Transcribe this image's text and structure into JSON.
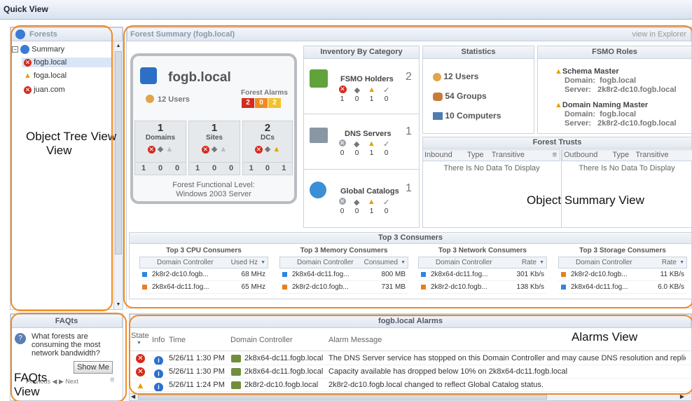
{
  "window": {
    "title": "Quick View"
  },
  "forests_panel": {
    "title": "Forests",
    "tree": [
      {
        "label": "Summary",
        "level": 0
      },
      {
        "label": "fogb.local",
        "level": 1,
        "status": "error"
      },
      {
        "label": "foga.local",
        "level": 1,
        "status": "warning"
      },
      {
        "label": "juan.com",
        "level": 1,
        "status": "error"
      }
    ]
  },
  "annotations": {
    "tree_view": "Object Tree View",
    "summary_view": "Object Summary View",
    "faqts_view_a": "FAQts",
    "faqts_view_b": "View",
    "alarms_view": "Alarms View"
  },
  "summary": {
    "title": "Forest Summary (fogb.local)",
    "view_link": "view in Explorer",
    "forest_name": "fogb.local",
    "users": "12 Users",
    "alarms_label": "Forest Alarms",
    "alarm_counts": [
      "2",
      "0",
      "2"
    ],
    "stats": [
      {
        "num": "1",
        "label": "Domains",
        "counts": [
          "1",
          "0",
          "0"
        ]
      },
      {
        "num": "1",
        "label": "Sites",
        "counts": [
          "1",
          "0",
          "0"
        ]
      },
      {
        "num": "2",
        "label": "DCs",
        "counts": [
          "1",
          "0",
          "1"
        ]
      }
    ],
    "functional_level_label": "Forest Functional Level:",
    "functional_level": "Windows 2003 Server"
  },
  "inventory": {
    "title": "Inventory By Category",
    "items": [
      {
        "label": "FSMO Holders",
        "count": "2",
        "sub": [
          "1",
          "0",
          "1",
          "0"
        ]
      },
      {
        "label": "DNS Servers",
        "count": "1",
        "sub": [
          "0",
          "0",
          "1",
          "0"
        ]
      },
      {
        "label": "Global Catalogs",
        "count": "1",
        "sub": [
          "0",
          "0",
          "1",
          "0"
        ]
      }
    ]
  },
  "statistics": {
    "title": "Statistics",
    "items": [
      "12 Users",
      "54 Groups",
      "10 Computers"
    ]
  },
  "fsmo": {
    "title": "FSMO Roles",
    "roles": [
      {
        "name": "Schema Master",
        "domain_label": "Domain:",
        "domain": "fogb.local",
        "server_label": "Server:",
        "server": "2k8r2-dc10.fogb.local"
      },
      {
        "name": "Domain Naming Master",
        "domain_label": "Domain:",
        "domain": "fogb.local",
        "server_label": "Server:",
        "server": "2k8r2-dc10.fogb.local"
      }
    ]
  },
  "trusts": {
    "title": "Forest Trusts",
    "in_cols": [
      "Inbound",
      "Type",
      "Transitive"
    ],
    "out_cols": [
      "Outbound",
      "Type",
      "Transitive"
    ],
    "empty": "There Is No Data To Display"
  },
  "consumers": {
    "title": "Top 3 Consumers",
    "groups": [
      {
        "title": "Top 3 CPU Consumers",
        "col1": "Domain Controller",
        "col2": "Used Hz",
        "rows": [
          [
            "2k8r2-dc10.fogb...",
            "68 MHz",
            "#2e86de"
          ],
          [
            "2k8x64-dc11.fog...",
            "65 MHz",
            "#e67e22"
          ]
        ]
      },
      {
        "title": "Top 3 Memory Consumers",
        "col1": "Domain Controller",
        "col2": "Consumed",
        "rows": [
          [
            "2k8x64-dc11.fog...",
            "800 MB",
            "#2e86de"
          ],
          [
            "2k8r2-dc10.fogb...",
            "731 MB",
            "#e67e22"
          ]
        ]
      },
      {
        "title": "Top 3 Network Consumers",
        "col1": "Domain Controller",
        "col2": "Rate",
        "rows": [
          [
            "2k8x64-dc11.fog...",
            "301 Kb/s",
            "#2e86de"
          ],
          [
            "2k8r2-dc10.fogb...",
            "138 Kb/s",
            "#e67e22"
          ]
        ]
      },
      {
        "title": "Top 3 Storage Consumers",
        "col1": "Domain Controller",
        "col2": "Rate",
        "rows": [
          [
            "2k8r2-dc10.fogb...",
            "11 KB/s",
            "#e67e22"
          ],
          [
            "2k8x64-dc11.fog...",
            "6.0 KB/s",
            "#2e86de"
          ]
        ]
      }
    ]
  },
  "faqts": {
    "title": "FAQts",
    "question": "What forests are consuming the most network bandwidth?",
    "show_me": "Show Me",
    "previous": "Previous",
    "next": "Next"
  },
  "alarms": {
    "title": "fogb.local Alarms",
    "cols": {
      "state": "State",
      "info": "Info",
      "time": "Time",
      "dc": "Domain Controller",
      "msg": "Alarm Message"
    },
    "rows": [
      {
        "state": "error",
        "time": "5/26/11 1:30 PM",
        "dc": "2k8x64-dc11.fogb.local",
        "msg": "The DNS Server service has stopped on this Domain Controller and may cause DNS resolution and replicati"
      },
      {
        "state": "error",
        "time": "5/26/11 1:30 PM",
        "dc": "2k8x64-dc11.fogb.local",
        "msg": "Capacity available has dropped below 10% on 2k8x64-dc11.fogb.local"
      },
      {
        "state": "warning",
        "time": "5/26/11 1:24 PM",
        "dc": "2k8r2-dc10.fogb.local",
        "msg": "2k8r2-dc10.fogb.local changed to reflect Global Catalog status."
      }
    ]
  }
}
